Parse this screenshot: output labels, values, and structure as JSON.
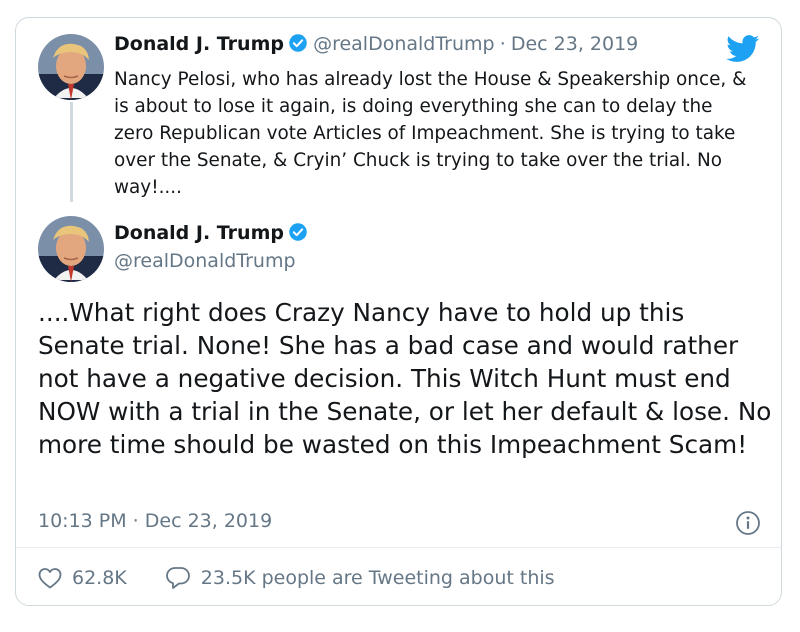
{
  "tweet1": {
    "name": "Donald J. Trump",
    "handle": "@realDonaldTrump",
    "separator": "·",
    "date": "Dec 23, 2019",
    "text": "Nancy Pelosi, who has already lost the House & Speakership once, & is about to lose it again, is doing everything she can to delay the zero Republican vote Articles of Impeachment. She is trying to take over the Senate, & Cryin’ Chuck is trying to take over the trial. No way!...."
  },
  "tweet2": {
    "name": "Donald J. Trump",
    "handle": "@realDonaldTrump",
    "text": "....What right does Crazy Nancy have to hold up this Senate trial. None! She has a bad case and would rather not have a negative decision. This Witch Hunt must end NOW with a trial in the Senate, or let her default & lose. No more time should be wasted on this Impeachment Scam!",
    "timestamp": "10:13 PM · Dec 23, 2019",
    "likes": "62.8K",
    "replies_text": "23.5K people are Tweeting about this"
  },
  "colors": {
    "text": "#14171a",
    "secondary": "#657786",
    "twitter_blue": "#1da1f2",
    "border": "#cfd9de"
  },
  "icons": [
    "twitter-bird-icon",
    "verified-badge-icon",
    "info-icon",
    "heart-icon",
    "reply-bubble-icon"
  ]
}
